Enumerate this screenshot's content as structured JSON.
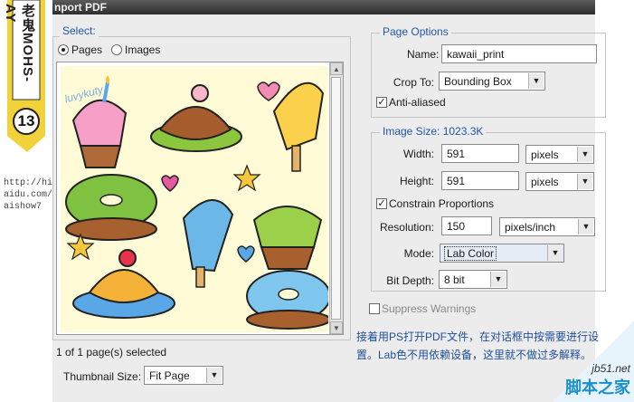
{
  "window": {
    "title": "nport PDF"
  },
  "select_group": {
    "label": "Select:",
    "options": [
      {
        "label": "Pages",
        "selected": true
      },
      {
        "label": "Images",
        "selected": false
      }
    ],
    "status": "1 of 1 page(s) selected",
    "thumbnail_label": "Thumbnail Size:",
    "thumbnail_value": "Fit Page",
    "doodle_text": "luvykuty"
  },
  "page_options": {
    "label": "Page Options",
    "name_label": "Name:",
    "name_value": "kawaii_print",
    "crop_label": "Crop To:",
    "crop_value": "Bounding Box",
    "anti_aliased_label": "Anti-aliased",
    "anti_aliased_checked": true
  },
  "image_size": {
    "label": "Image Size: 1023.3K",
    "width_label": "Width:",
    "width_value": "591",
    "width_unit": "pixels",
    "height_label": "Height:",
    "height_value": "591",
    "height_unit": "pixels",
    "constrain_label": "Constrain Proportions",
    "constrain_checked": true,
    "resolution_label": "Resolution:",
    "resolution_value": "150",
    "resolution_unit": "pixels/inch",
    "mode_label": "Mode:",
    "mode_value": "Lab Color",
    "bitdepth_label": "Bit Depth:",
    "bitdepth_value": "8 bit"
  },
  "suppress_warnings_label": "Suppress Warnings",
  "tutorial": {
    "tag_text": "老鬼MOHS-AY",
    "tag_number": "13",
    "url_lines": [
      "http://hi.b",
      "aidu.com/",
      "aishow7"
    ],
    "caption": "接着用PS打开PDF文件，在对话框中按需要进行设置。Lab色不用依赖设备，这里就不做过多解释。"
  },
  "watermark": {
    "line1": "jb51.net",
    "line2": "脚本之家"
  },
  "colors": {
    "accent_blue": "#2255aa",
    "dialog_bg": "#ececec",
    "preview_bg": "#fffbd6",
    "tag_yellow": "#f2d23a"
  }
}
